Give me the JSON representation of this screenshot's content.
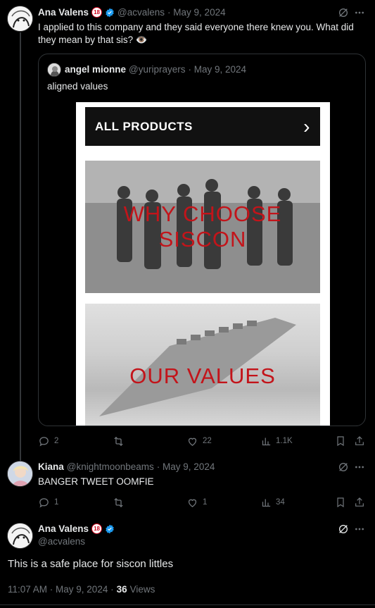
{
  "tweet1": {
    "author": "Ana Valens",
    "badge": "18",
    "handle": "@acvalens",
    "date": "· May 9, 2024",
    "text": "I applied to this company and they said everyone there knew you. What did they mean by that sis? 👁️",
    "quote": {
      "author": "angel mionne",
      "handle": "@yuriprayers",
      "date": "· May 9, 2024",
      "text": "aligned values",
      "image": {
        "bar_label": "ALL PRODUCTS",
        "bar_chevron": "›",
        "panel1_line1": "WHY CHOOSE",
        "panel1_line2": "SISCON",
        "panel2_label": "OUR VALUES"
      }
    },
    "stats": {
      "replies": "2",
      "retweets": "",
      "likes": "22",
      "views": "1.1K"
    }
  },
  "tweet2": {
    "author": "Kiana",
    "handle": "@knightmoonbeams",
    "date": "· May 9, 2024",
    "text": "BANGER TWEET OOMFIE",
    "stats": {
      "replies": "1",
      "retweets": "",
      "likes": "1",
      "views": "34"
    }
  },
  "tweet3": {
    "author": "Ana Valens",
    "badge": "18",
    "handle": "@acvalens",
    "text": "This is a safe place for siscon littles",
    "time": "11:07 AM · May 9, 2024 ·",
    "views_count": "36",
    "views_label": "Views"
  },
  "colors": {
    "accent": "#1d9bf0",
    "muted": "#71767b",
    "border": "#2f3336",
    "brand_red": "#c3141a"
  }
}
